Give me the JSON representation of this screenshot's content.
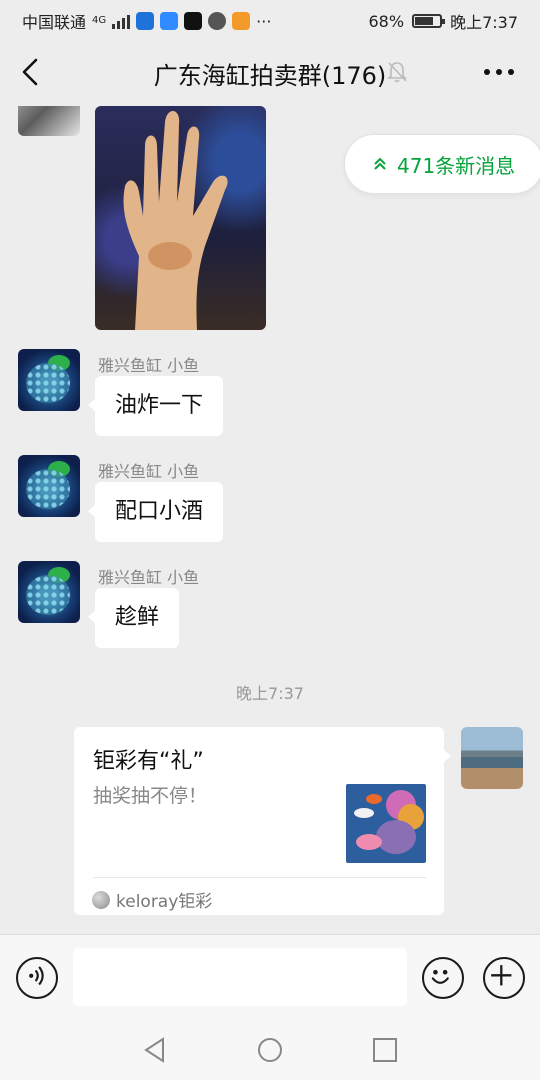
{
  "status_bar": {
    "carrier": "中国联通",
    "network": "4G",
    "battery": "68%",
    "time": "晚上7:37"
  },
  "header": {
    "title": "广东海缸拍卖群(176)"
  },
  "new_messages": {
    "label": "471条新消息"
  },
  "messages": [
    {
      "sender": "雅兴鱼缸 小鱼",
      "text": "油炸一下"
    },
    {
      "sender": "雅兴鱼缸 小鱼",
      "text": "配口小酒"
    },
    {
      "sender": "雅兴鱼缸 小鱼",
      "text": "趁鲜"
    }
  ],
  "timestamp": "晚上7:37",
  "card": {
    "title": "钜彩有“礼”",
    "description": "抽奖抽不停！",
    "source": "keloray钜彩"
  },
  "colors": {
    "accent_green": "#07a33b",
    "background": "#ededed"
  },
  "icons": {
    "back": "chevron-left-icon",
    "mute": "bell-off-icon",
    "more": "more-icon",
    "voice": "voice-icon",
    "emoji": "emoji-icon",
    "plus": "plus-icon"
  }
}
